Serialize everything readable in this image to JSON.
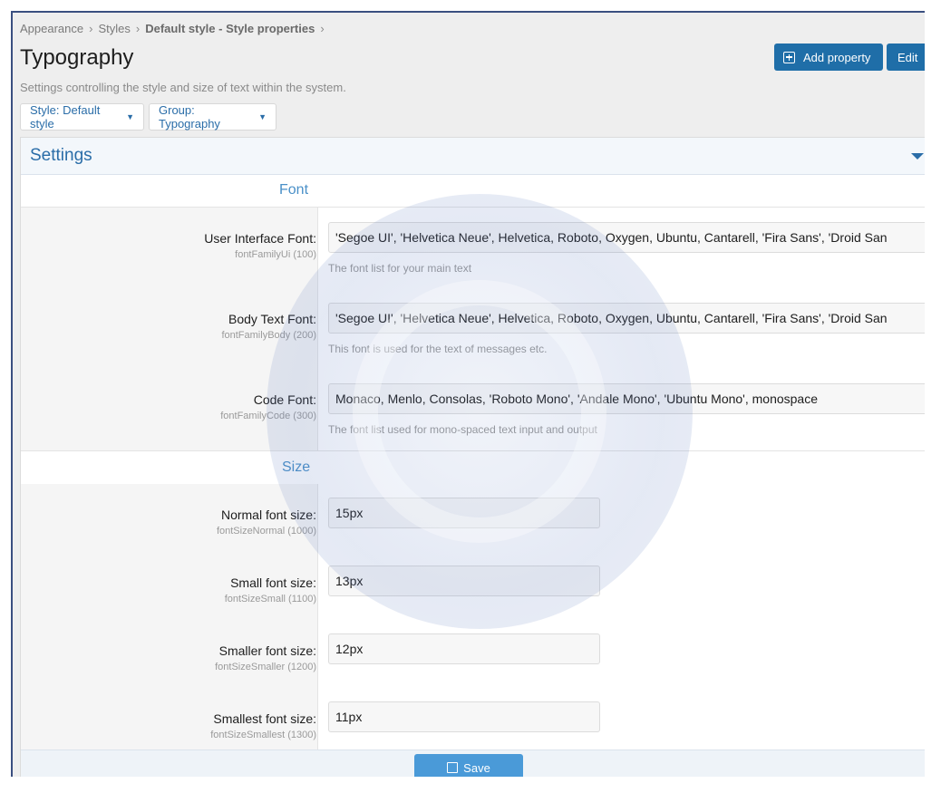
{
  "breadcrumb": [
    "Appearance",
    "Styles",
    "Default style - Style properties"
  ],
  "header": {
    "title": "Typography",
    "description": "Settings controlling the style and size of text within the system.",
    "add_property_label": "Add property",
    "edit_label": "Edit"
  },
  "filters": {
    "style_label": "Style: Default style",
    "group_label": "Group: Typography"
  },
  "block": {
    "title": "Settings"
  },
  "sections": {
    "font": {
      "title": "Font",
      "rows": [
        {
          "label": "User Interface Font:",
          "sub": "fontFamilyUi (100)",
          "value": "'Segoe UI', 'Helvetica Neue', Helvetica, Roboto, Oxygen, Ubuntu, Cantarell, 'Fira Sans', 'Droid San",
          "hint": "The font list for your main text"
        },
        {
          "label": "Body Text Font:",
          "sub": "fontFamilyBody (200)",
          "value": "'Segoe UI', 'Helvetica Neue', Helvetica, Roboto, Oxygen, Ubuntu, Cantarell, 'Fira Sans', 'Droid San",
          "hint": "This font is used for the text of messages etc."
        },
        {
          "label": "Code Font:",
          "sub": "fontFamilyCode (300)",
          "value": "Monaco, Menlo, Consolas, 'Roboto Mono', 'Andale Mono', 'Ubuntu Mono', monospace",
          "hint": "The font list used for mono-spaced text input and output"
        }
      ]
    },
    "size": {
      "title": "Size",
      "rows": [
        {
          "label": "Normal font size:",
          "sub": "fontSizeNormal (1000)",
          "value": "15px"
        },
        {
          "label": "Small font size:",
          "sub": "fontSizeSmall (1100)",
          "value": "13px"
        },
        {
          "label": "Smaller font size:",
          "sub": "fontSizeSmaller (1200)",
          "value": "12px"
        },
        {
          "label": "Smallest font size:",
          "sub": "fontSizeSmallest (1300)",
          "value": "11px"
        }
      ]
    }
  },
  "footer": {
    "save_label": "Save"
  },
  "colors": {
    "accent": "#1f6ea8",
    "link": "#2a6da8",
    "section": "#4a90c8"
  }
}
